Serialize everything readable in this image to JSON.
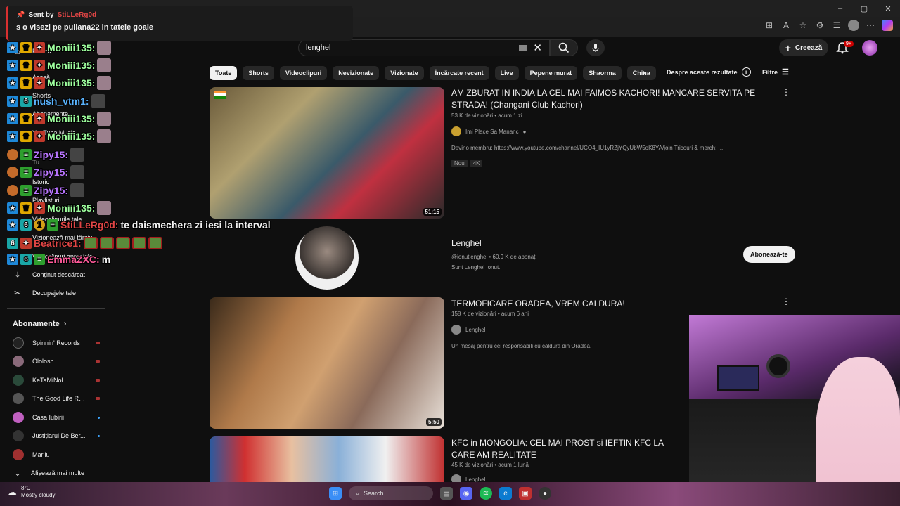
{
  "browser": {
    "window_controls": [
      "–",
      "▢",
      "✕"
    ]
  },
  "header": {
    "search_value": "lenghel",
    "create_label": "Creează",
    "notif_badge": "9+"
  },
  "chips": [
    "Toate",
    "Shorts",
    "Videoclipuri",
    "Nevizionate",
    "Vizionate",
    "Încărcate recent",
    "Live",
    "Pepene murat",
    "Shaorma",
    "China"
  ],
  "chips_extra": {
    "about": "Despre aceste rezultate",
    "filters": "Filtre"
  },
  "sidebar": {
    "items": [
      {
        "label": "Pentru",
        "icon": "home-icon"
      },
      {
        "label": "Acasă",
        "icon": "home-icon"
      },
      {
        "label": "Shorts",
        "icon": "shorts-icon"
      },
      {
        "label": "Abonamente",
        "icon": "subscriptions-icon"
      },
      {
        "label": "YouTube Music",
        "icon": "music-icon"
      },
      {
        "label": "Tu",
        "icon": "you-icon"
      },
      {
        "label": "Istoric",
        "icon": "history-icon"
      },
      {
        "label": "Playlisturi",
        "icon": "playlist-icon"
      },
      {
        "label": "Videoclipurile tale",
        "icon": "video-icon"
      },
      {
        "label": "Vizionează mai târziu",
        "icon": "clock-icon"
      },
      {
        "label": "Videoclipuri apreciate",
        "icon": "like-icon"
      },
      {
        "label": "Conținut descărcat",
        "icon": "download-icon"
      },
      {
        "label": "Decupajele tale",
        "icon": "scissors-icon"
      }
    ],
    "subs_heading": "Abonamente",
    "subs": [
      {
        "name": "Spinnin' Records",
        "status": "live",
        "color": "#222"
      },
      {
        "name": "Ololosh",
        "status": "live",
        "color": "#8a6a7a"
      },
      {
        "name": "KeTaMiNoL",
        "status": "live",
        "color": "#2a4a3a"
      },
      {
        "name": "The Good Life Ra...",
        "status": "live",
        "color": "#555"
      },
      {
        "name": "Casa Iubirii",
        "status": "new",
        "color": "#c060c0"
      },
      {
        "name": "Justițiarul De Ber...",
        "status": "new",
        "color": "#333"
      },
      {
        "name": "Marilu",
        "status": "",
        "color": "#a03030"
      }
    ],
    "show_more": "Afișează mai multe"
  },
  "chat": {
    "notice_prefix": "Sent by",
    "notice_sender": "StiLLeRg0d",
    "notice_message": "s o visezi pe puliana22 in tatele goale",
    "lines": [
      {
        "user": "Moniii135:",
        "msg": ""
      },
      {
        "user": "Moniii135:",
        "msg": ""
      },
      {
        "user": "Moniii135:",
        "msg": ""
      },
      {
        "user": "nush_vtm1:",
        "msg": ""
      },
      {
        "user": "Moniii135:",
        "msg": ""
      },
      {
        "user": "Moniii135:",
        "msg": ""
      },
      {
        "user": "Zipy15:",
        "msg": ""
      },
      {
        "user": "Zipy15:",
        "msg": ""
      },
      {
        "user": "Zipy15:",
        "msg": ""
      },
      {
        "user": "Moniii135:",
        "msg": ""
      },
      {
        "user": "StiLLeRg0d:",
        "msg": "te daismechera zi iesi la interval"
      },
      {
        "user": "Beatrice1:",
        "msg": ""
      },
      {
        "user": "EmmaZXC:",
        "msg": "m"
      }
    ]
  },
  "results": {
    "video1": {
      "title": "AM ZBURAT IN INDIA LA CEL MAI FAIMOS KACHORI! MANCARE SERVITA PE STRADA! (Changani Club Kachori)",
      "meta": "53 K de vizionări • acum 1 zi",
      "channel": "Imi Place Sa Mananc",
      "description": "Devino membru: https://www.youtube.com/channel/UCO4_IU1yRZjYQyUbW5oK8YA/join Tricouri & merch: ...",
      "tags": [
        "Nou",
        "4K"
      ],
      "duration": "51:15"
    },
    "channel": {
      "name": "Lenghel",
      "meta": "@ionutlenghel • 60,9 K de abonați",
      "desc": "Sunt Lenghel Ionut.",
      "subscribe": "Abonează-te"
    },
    "video2": {
      "title": "TERMOFICARE ORADEA, VREM CALDURA!",
      "meta": "158 K de vizionări • acum 6 ani",
      "channel": "Lenghel",
      "description": "Un mesaj pentru cei responsabili cu caldura din Oradea.",
      "duration": "5:50"
    },
    "video3": {
      "title": "KFC in MONGOLIA: CEL MAI PROST si IEFTIN KFC LA CARE AM REALITATE",
      "meta": "45 K de vizionări • acum 1 lună",
      "channel": "Lenghel"
    }
  },
  "taskbar": {
    "temp": "8°C",
    "weather": "Mostly cloudy",
    "search": "Search"
  }
}
